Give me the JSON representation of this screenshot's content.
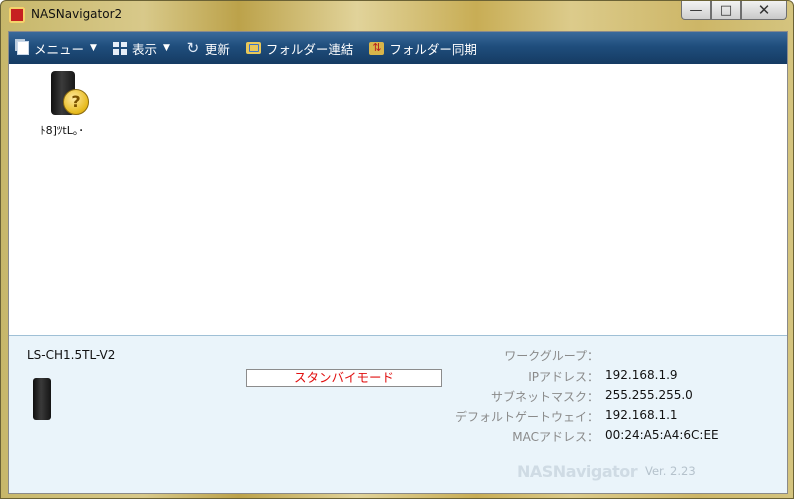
{
  "window": {
    "title": "NASNavigator2",
    "minimize": "—",
    "maximize": "□",
    "close": "✕"
  },
  "toolbar": {
    "items": [
      {
        "label": "メニュー",
        "icon": "document-icon",
        "dropdown": true
      },
      {
        "label": "表示",
        "icon": "view-grid-icon",
        "dropdown": true
      },
      {
        "label": "更新",
        "icon": "refresh-icon",
        "dropdown": false
      },
      {
        "label": "フォルダー連結",
        "icon": "folder-link-icon",
        "dropdown": false
      },
      {
        "label": "フォルダー同期",
        "icon": "folder-sync-icon",
        "dropdown": false
      }
    ]
  },
  "devices": [
    {
      "label": "ﾄ8]ﾂtL｡･",
      "badge": "?"
    }
  ],
  "info": {
    "device_name": "LS-CH1.5TL-V2",
    "status": "スタンバイモード",
    "rows": [
      {
        "label": "ワークグループ：",
        "value": ""
      },
      {
        "label": "IPアドレス：",
        "value": "192.168.1.9"
      },
      {
        "label": "サブネットマスク：",
        "value": "255.255.255.0"
      },
      {
        "label": "デフォルトゲートウェイ：",
        "value": "192.168.1.1"
      },
      {
        "label": "MACアドレス：",
        "value": "00:24:A5:A4:6C:EE"
      }
    ],
    "brand": "NASNavigator",
    "version": "Ver. 2.23"
  },
  "colors": {
    "toolbar": "#1f4d7c",
    "status_text": "#e01010",
    "panel_bg": "#eaf4fa"
  }
}
